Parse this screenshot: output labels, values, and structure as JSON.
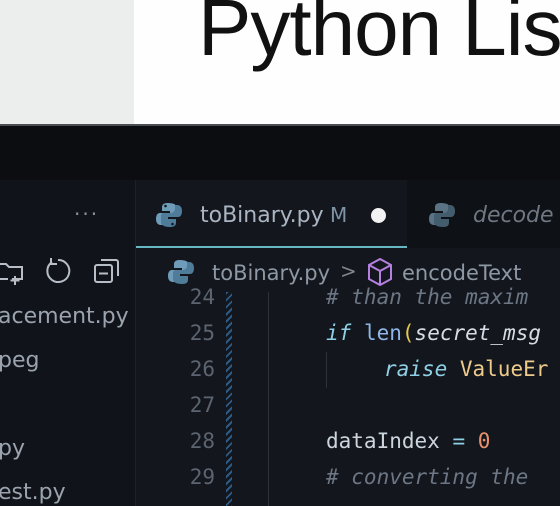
{
  "slide": {
    "title": "Python Lis"
  },
  "sidebar": {
    "more_label": "···",
    "files": [
      {
        "name": "acement.py"
      },
      {
        "name": "peg"
      },
      {
        "name": "py"
      },
      {
        "name": "est.py"
      }
    ]
  },
  "tabs": [
    {
      "label": "toBinary.py",
      "modified": "M",
      "active": true
    },
    {
      "label": "decode",
      "active": false
    }
  ],
  "breadcrumb": {
    "file": "toBinary.py",
    "separator": ">",
    "symbol": "encodeText"
  },
  "editor": {
    "lines": [
      {
        "number": "24",
        "text": "# than the maxim"
      },
      {
        "number": "25",
        "kw": "if",
        "fn": "len",
        "paren": "(",
        "arg": "secret_msg"
      },
      {
        "number": "26",
        "kw": "raise",
        "text": "ValueEr"
      },
      {
        "number": "27"
      },
      {
        "number": "28",
        "var": "dataIndex",
        "op": "=",
        "num": "0"
      },
      {
        "number": "29",
        "text": "# converting the"
      }
    ]
  },
  "colors": {
    "accent": "#66b6c4",
    "keyword": "#8fd0e6",
    "comment": "#6c7684",
    "number": "#e7906a",
    "class": "#eecb8a"
  }
}
